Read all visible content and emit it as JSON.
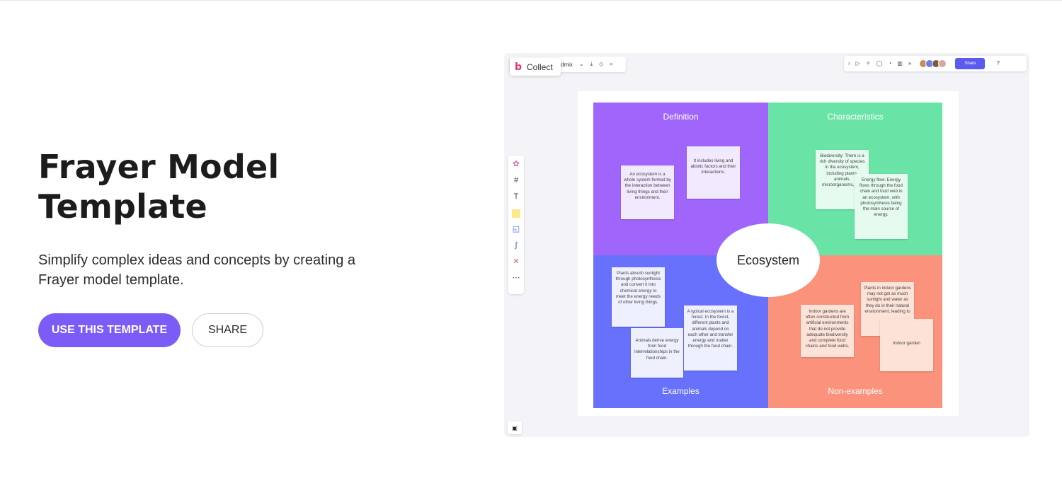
{
  "hero": {
    "title_line1": "Frayer Model",
    "title_line2": "Template",
    "description": "Simplify complex ideas and concepts by creating a Frayer model template.",
    "primary_cta": "USE THIS TEMPLATE",
    "secondary_cta": "SHARE"
  },
  "preview": {
    "collect_label": "Collect",
    "breadcrumb_fragment": "dmix",
    "share_label": "Share",
    "center_label": "Ecosystem",
    "quadrants": {
      "top_left": "Definition",
      "top_right": "Characteristics",
      "bottom_left": "Examples",
      "bottom_right": "Non-examples"
    },
    "notes": {
      "def_1": "An ecosystem is a whole system formed by the interaction between living things and their environment.",
      "def_2": "It includes living and abiotic factors and their interactions.",
      "char_1": "Biodiversity: There is a rich diversity of species in the ecosystem, including plants, animals, microorganisms, etc.",
      "char_2": "Energy flow: Energy flows through the food chain and food web in an ecosystem, with photosynthesis being the main source of energy.",
      "ex_1": "Plants absorb sunlight through photosynthesis and convert it into chemical energy to meet the energy needs of other living things.",
      "ex_2": "Animals derive energy from food interrelationships in the food chain.",
      "ex_3": "A typical ecosystem is a forest. In the forest, different plants and animals depend on each other and transfer energy and matter through the food chain.",
      "non_1": "Indoor gardens are often constructed from artificial environments that do not provide adequate biodiversity and complete food chains and food webs.",
      "non_2": "Plants in indoor gardens may not get as much sunlight and water as they do in their natural environment, leading to",
      "non_3": "Indoor garden"
    },
    "colors": {
      "definition": "#a066fb",
      "characteristics": "#6ae4a6",
      "examples": "#6871fc",
      "non_examples": "#fb937c",
      "accent": "#7b5cf6"
    }
  }
}
